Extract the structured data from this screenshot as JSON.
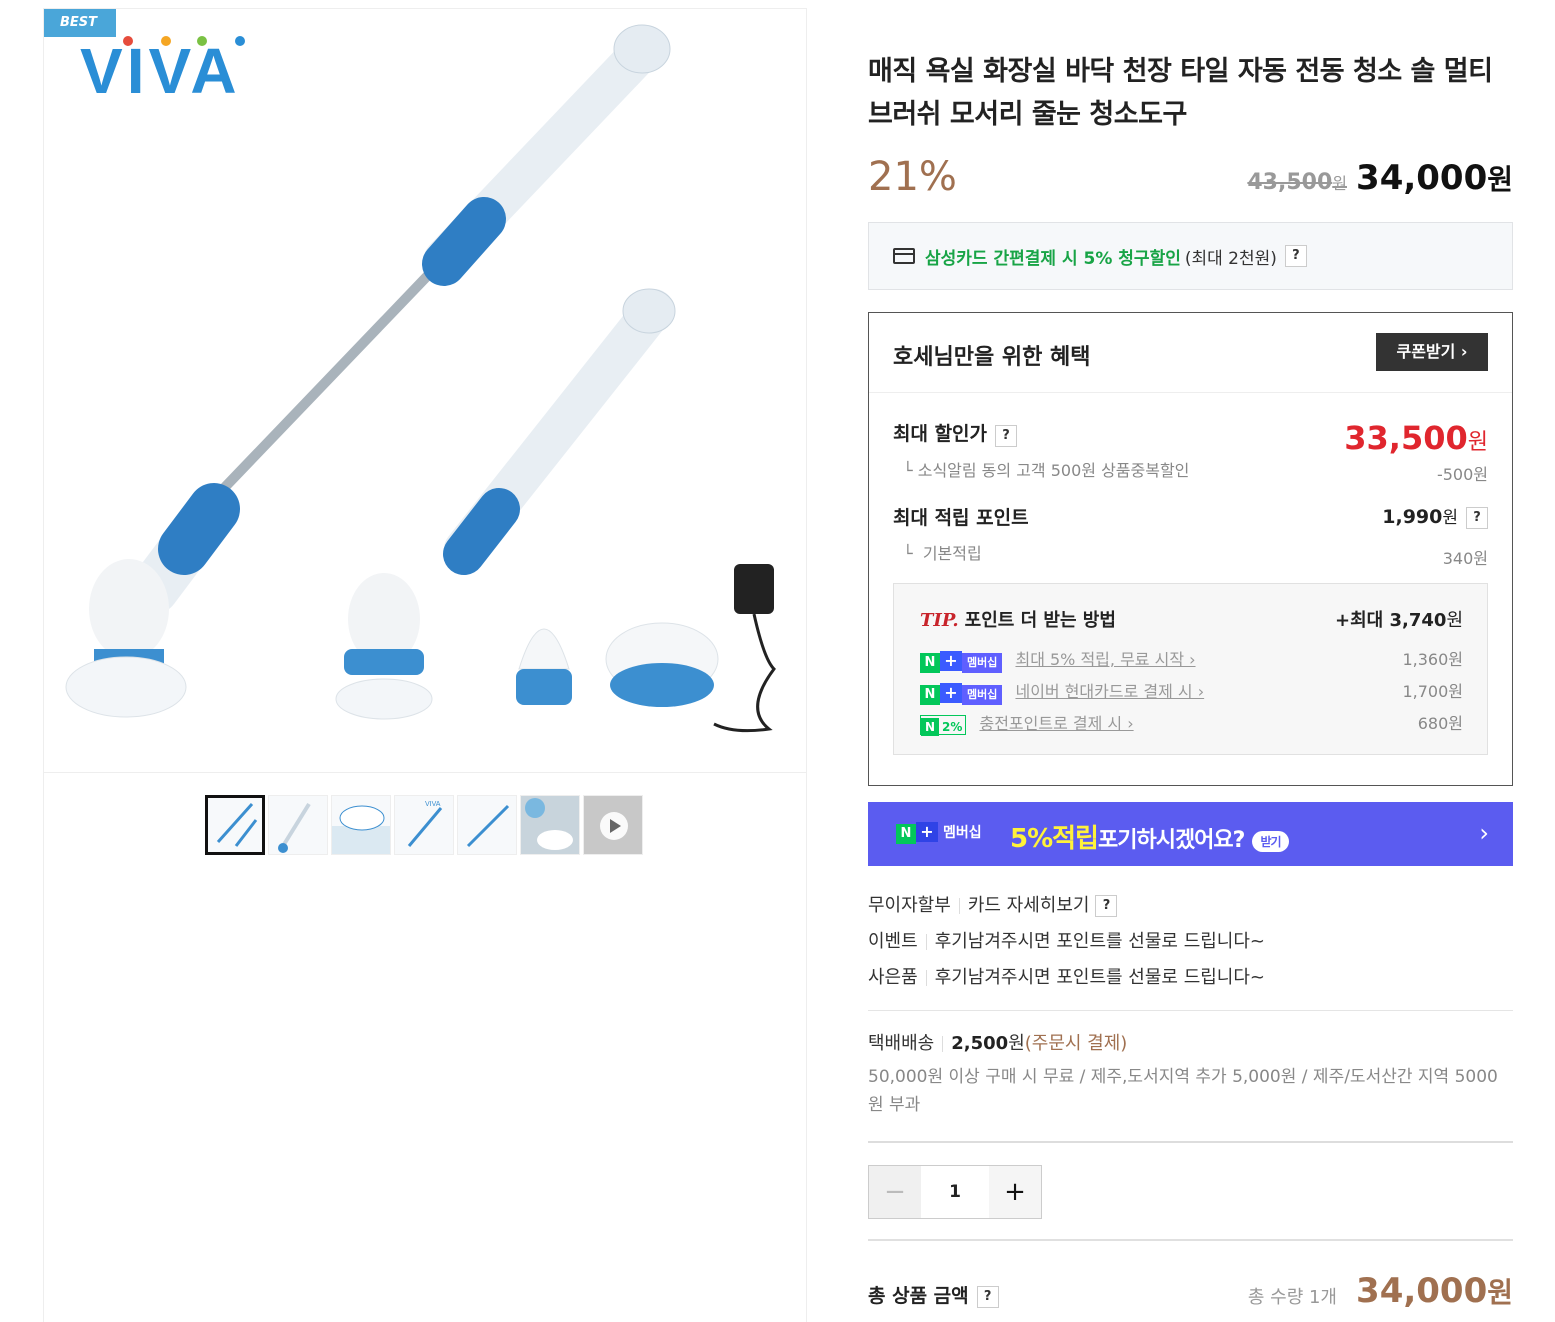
{
  "product": {
    "badge": "BEST",
    "brand": "VIVA",
    "title": "매직 욕실 화장실 바닥 천장 타일 자동 전동 청소 솔 멀티 브러쉬 모서리 줄눈 청소도구",
    "discount_rate": "21%",
    "original_price": "43,500",
    "original_unit": "원",
    "final_price": "34,000",
    "final_unit": "원"
  },
  "card_promo": {
    "highlight": "삼성카드 간편결제 시 5% 청구할인",
    "note": "(최대 2천원)",
    "help": "?"
  },
  "benefit": {
    "title": "호세님만을 위한 혜택",
    "coupon_button": "쿠폰받기 ›",
    "max_discount_label": "최대 할인가",
    "max_discount_help": "?",
    "max_discount_price": "33,500",
    "max_discount_unit": "원",
    "max_discount_sub": "소식알림 동의 고객 500원 상품중복할인",
    "max_discount_sub_amount": "-500원",
    "points_label": "최대 적립 포인트",
    "points_value": "1,990",
    "points_unit": "원",
    "points_help": "?",
    "points_sub": "기본적립",
    "points_sub_amount": "340원",
    "tip": {
      "tag": "TIP.",
      "title": "포인트 더 받는 방법",
      "total_prefix": "+최대 3,740",
      "total_unit": "원",
      "items": [
        {
          "badge": "멤버십",
          "label": "최대 5% 적립, 무료 시작 ›",
          "amount": "1,360원"
        },
        {
          "badge": "멤버십",
          "label": "네이버 현대카드로 결제 시 ›",
          "amount": "1,700원"
        },
        {
          "badge": "2%",
          "label": "충전포인트로 결제 시 ›",
          "amount": "680원"
        }
      ]
    }
  },
  "membership_banner": {
    "badge_text": "멤버십",
    "highlight": "5%적립",
    "text": "포기하시겠어요?",
    "get": "받기",
    "arrow": "›"
  },
  "misc": {
    "installment": "무이자할부",
    "card_detail": "카드 자세히보기",
    "help": "?",
    "event_label": "이벤트",
    "event_text": "후기남겨주시면 포인트를 선물로 드립니다~",
    "gift_label": "사은품",
    "gift_text": "후기남겨주시면 포인트를 선물로 드립니다~"
  },
  "shipping": {
    "method": "택배배송",
    "fee": "2,500",
    "fee_unit": "원",
    "note": "(주문시 결제)",
    "desc": "50,000원 이상 구매 시 무료 / 제주,도서지역 추가 5,000원 / 제주/도서산간 지역 5000원 부과"
  },
  "quantity": {
    "minus": "−",
    "value": "1",
    "plus": "+"
  },
  "total": {
    "label": "총 상품 금액",
    "help": "?",
    "count": "총 수량 1개",
    "price": "34,000",
    "unit": "원"
  },
  "colors": {
    "accent_blue": "#4aa6d9",
    "discount_brown": "#a07050",
    "sale_red": "#e0262e",
    "naver_green": "#03c75a",
    "membership_purple": "#5b5cf0"
  }
}
